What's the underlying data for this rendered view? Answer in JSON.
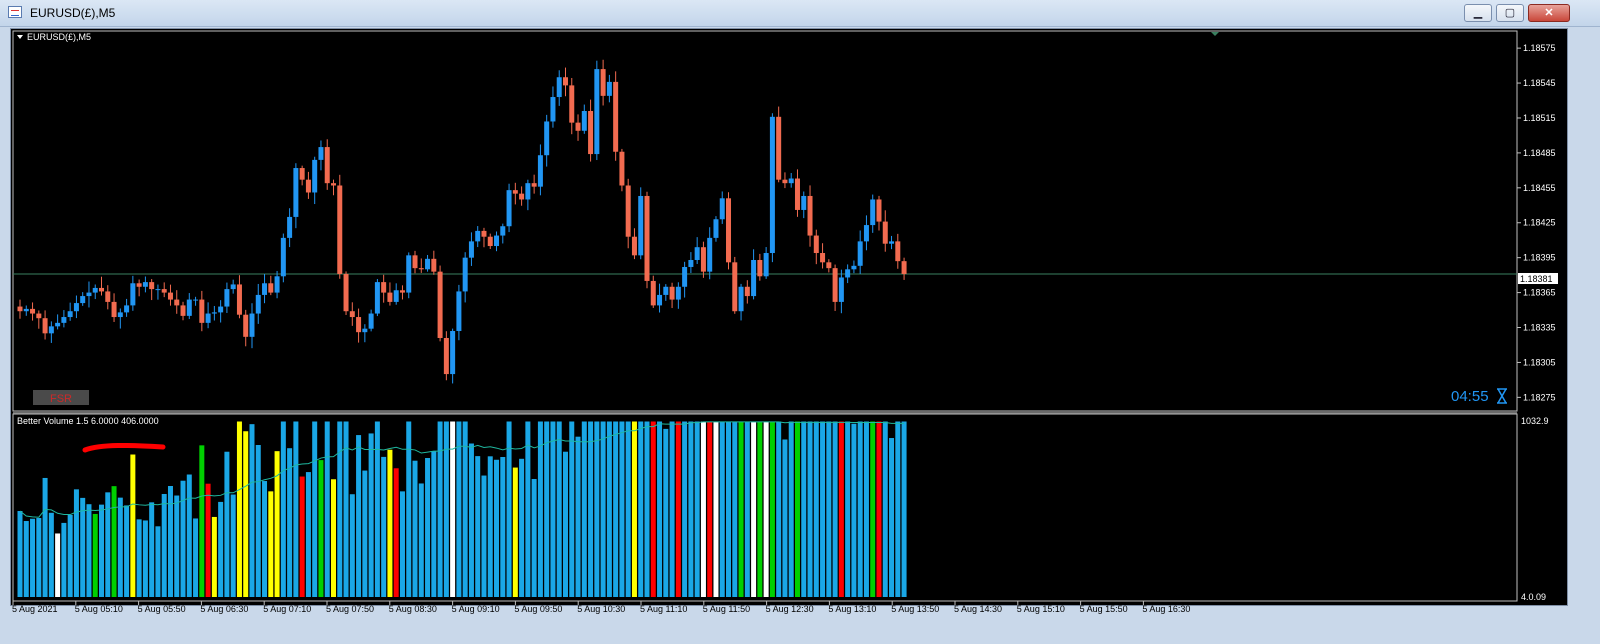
{
  "window": {
    "title": "EURUSD(£),M5",
    "buttons": {
      "minimize": "▁",
      "maximize": "▢",
      "close": "✕"
    }
  },
  "chart": {
    "symbol_label": "EURUSD(£),M5",
    "current_price": "1.18381",
    "countdown": "04:55",
    "fsr_label": "FSR",
    "hourglass_icon": "hourglass-icon",
    "colors": {
      "bull": "#2196f3",
      "bear": "#f26b50",
      "bg": "#000000",
      "text": "#ffffff",
      "bid_line": "#3a7f5f"
    }
  },
  "indicator": {
    "label": "Better Volume 1.5 6.0000 406.0000",
    "scale_top": "1032.9",
    "scale_bottom": "4.0.09"
  },
  "chart_data": {
    "type": "candlestick",
    "title": "EURUSD(£),M5",
    "y_ticks": [
      "1.18575",
      "1.18545",
      "1.18515",
      "1.18485",
      "1.18455",
      "1.18425",
      "1.18395",
      "1.18365",
      "1.18335",
      "1.18305",
      "1.18275"
    ],
    "y_range": [
      1.18265,
      1.18588
    ],
    "x_ticks": [
      "5 Aug 2021",
      "5 Aug 05:10",
      "5 Aug 05:50",
      "5 Aug 06:30",
      "5 Aug 07:10",
      "5 Aug 07:50",
      "5 Aug 08:30",
      "5 Aug 09:10",
      "5 Aug 09:50",
      "5 Aug 10:30",
      "5 Aug 11:10",
      "5 Aug 11:50",
      "5 Aug 12:30",
      "5 Aug 13:10",
      "5 Aug 13:50",
      "5 Aug 14:30",
      "5 Aug 15:10",
      "5 Aug 15:50",
      "5 Aug 16:30"
    ],
    "close_series": [
      1.18349,
      1.18351,
      1.18347,
      1.18343,
      1.1833,
      1.18336,
      1.18339,
      1.18344,
      1.18349,
      1.18356,
      1.18362,
      1.18365,
      1.18369,
      1.18366,
      1.18357,
      1.18344,
      1.18348,
      1.18354,
      1.18373,
      1.1837,
      1.18374,
      1.18368,
      1.18368,
      1.18365,
      1.18359,
      1.18354,
      1.18345,
      1.18359,
      1.18359,
      1.18339,
      1.18347,
      1.18348,
      1.18353,
      1.18368,
      1.18372,
      1.18346,
      1.18327,
      1.18347,
      1.18363,
      1.18373,
      1.18365,
      1.18379,
      1.18412,
      1.1843,
      1.18472,
      1.18462,
      1.18451,
      1.18479,
      1.1849,
      1.18459,
      1.18457,
      1.18381,
      1.18349,
      1.18344,
      1.18331,
      1.18334,
      1.18347,
      1.18374,
      1.18365,
      1.18357,
      1.18367,
      1.18365,
      1.18397,
      1.18386,
      1.18385,
      1.18394,
      1.18383,
      1.18326,
      1.18295,
      1.18332,
      1.18366,
      1.18395,
      1.18409,
      1.18418,
      1.18413,
      1.18405,
      1.18414,
      1.18422,
      1.18453,
      1.1845,
      1.18445,
      1.18459,
      1.18456,
      1.18483,
      1.18512,
      1.18533,
      1.1855,
      1.18543,
      1.18511,
      1.18504,
      1.18521,
      1.18484,
      1.18557,
      1.18534,
      1.18546,
      1.18486,
      1.18457,
      1.18413,
      1.18397,
      1.18448,
      1.18375,
      1.18354,
      1.18363,
      1.1837,
      1.18359,
      1.1837,
      1.18387,
      1.18393,
      1.18404,
      1.18383,
      1.18412,
      1.18428,
      1.18446,
      1.18391,
      1.18349,
      1.1837,
      1.18362,
      1.18393,
      1.18379,
      1.18399,
      1.18516,
      1.18462,
      1.18459,
      1.18463,
      1.18436,
      1.18448,
      1.18414,
      1.18399,
      1.18391,
      1.18386,
      1.18357,
      1.18378,
      1.18385,
      1.18388,
      1.18409,
      1.18423,
      1.18445,
      1.18426,
      1.18407,
      1.18409,
      1.18392,
      1.18381
    ]
  }
}
